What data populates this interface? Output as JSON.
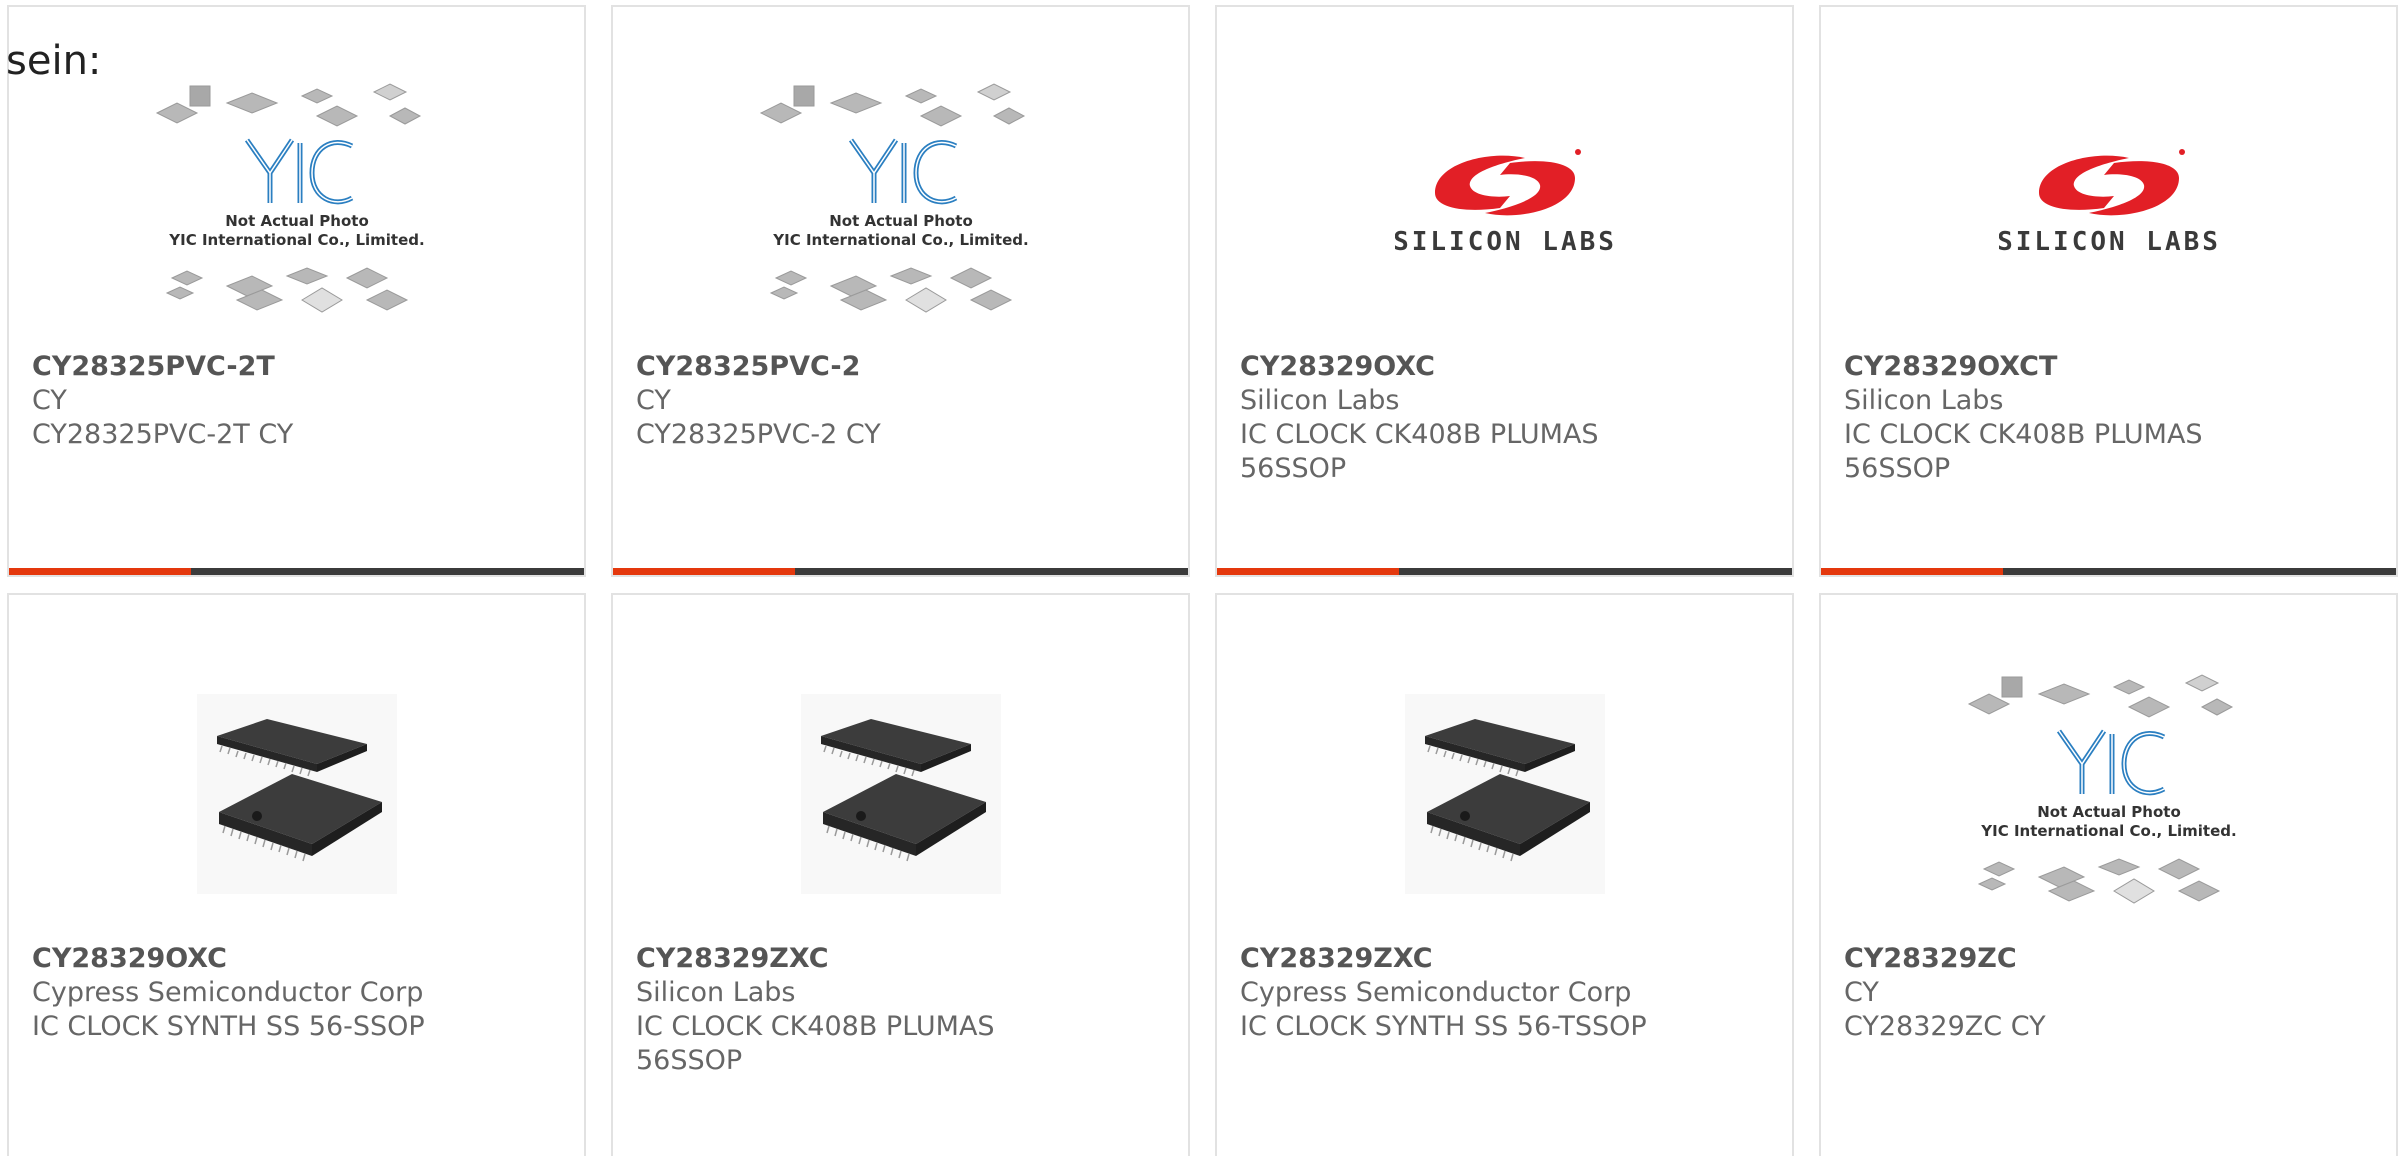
{
  "intro_text": "sein:",
  "colors": {
    "accent": "#e4380d",
    "bar": "#3b3b3b",
    "border": "#e2e2e2",
    "silabs_red": "#e21f26"
  },
  "placeholder": {
    "line1": "Not Actual Photo",
    "line2": "YIC International Co., Limited."
  },
  "silabs_logo_text": "SILICON LABS",
  "products": [
    {
      "part": "CY28325PVC-2T",
      "manufacturer": "CY",
      "description": [
        "CY28325PVC-2T CY"
      ],
      "image": "yic-placeholder",
      "bar": true
    },
    {
      "part": "CY28325PVC-2",
      "manufacturer": "CY",
      "description": [
        "CY28325PVC-2 CY"
      ],
      "image": "yic-placeholder",
      "bar": true
    },
    {
      "part": "CY28329OXC",
      "manufacturer": "Silicon Labs",
      "description": [
        "IC CLOCK CK408B PLUMAS",
        "56SSOP"
      ],
      "image": "silicon-labs-logo",
      "bar": true
    },
    {
      "part": "CY28329OXCT",
      "manufacturer": "Silicon Labs",
      "description": [
        "IC CLOCK CK408B PLUMAS",
        "56SSOP"
      ],
      "image": "silicon-labs-logo",
      "bar": true
    },
    {
      "part": "CY28329OXC",
      "manufacturer": "Cypress Semiconductor Corp",
      "description": [
        "IC CLOCK SYNTH SS 56-SSOP"
      ],
      "image": "ssop-chip-photo",
      "bar": false
    },
    {
      "part": "CY28329ZXC",
      "manufacturer": "Silicon Labs",
      "description": [
        "IC CLOCK CK408B PLUMAS",
        "56SSOP"
      ],
      "image": "ssop-chip-photo",
      "bar": false
    },
    {
      "part": "CY28329ZXC",
      "manufacturer": "Cypress Semiconductor Corp",
      "description": [
        "IC CLOCK SYNTH SS 56-TSSOP"
      ],
      "image": "ssop-chip-photo",
      "bar": false
    },
    {
      "part": "CY28329ZC",
      "manufacturer": "CY",
      "description": [
        "CY28329ZC CY"
      ],
      "image": "yic-placeholder",
      "bar": false
    }
  ]
}
